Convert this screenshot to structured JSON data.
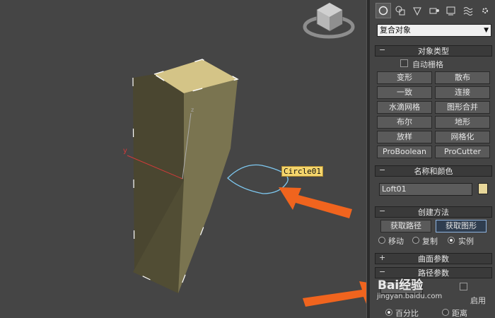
{
  "viewport": {
    "object_label": "Circle01",
    "axes": {
      "x": "x",
      "y": "y",
      "z": "z"
    }
  },
  "panel": {
    "tabs": [
      "create-tab",
      "modify-tab",
      "hierarchy-tab",
      "motion-tab",
      "display-tab",
      "utilities-tab"
    ],
    "category_dropdown": "复合对象",
    "object_type": {
      "title": "对象类型",
      "autogrid": "自动栅格",
      "buttons": [
        "变形",
        "散布",
        "一致",
        "连接",
        "水滴网格",
        "图形合并",
        "布尔",
        "地形",
        "放样",
        "网格化",
        "ProBoolean",
        "ProCutter"
      ]
    },
    "name_color": {
      "title": "名称和颜色",
      "name_value": "Loft01",
      "color": "#e7d79a"
    },
    "creation_method": {
      "title": "创建方法",
      "get_path": "获取路径",
      "get_shape": "获取图形",
      "radios": [
        "移动",
        "复制",
        "实例"
      ]
    },
    "surface_params": {
      "title": "曲面参数"
    },
    "path_params": {
      "title": "路径参数",
      "enable": "启用",
      "radios": [
        "百分比",
        "距离"
      ]
    },
    "watermark": {
      "logo": "Bai经验",
      "url": "jingyan.baidu.com"
    }
  },
  "colors": {
    "viewport_bg": "#454545",
    "box_front": "#4a4630",
    "box_side": "#7a7450",
    "box_top": "#d4c487",
    "shape_outline": "#7ec8f0",
    "arrow": "#f0641e"
  }
}
